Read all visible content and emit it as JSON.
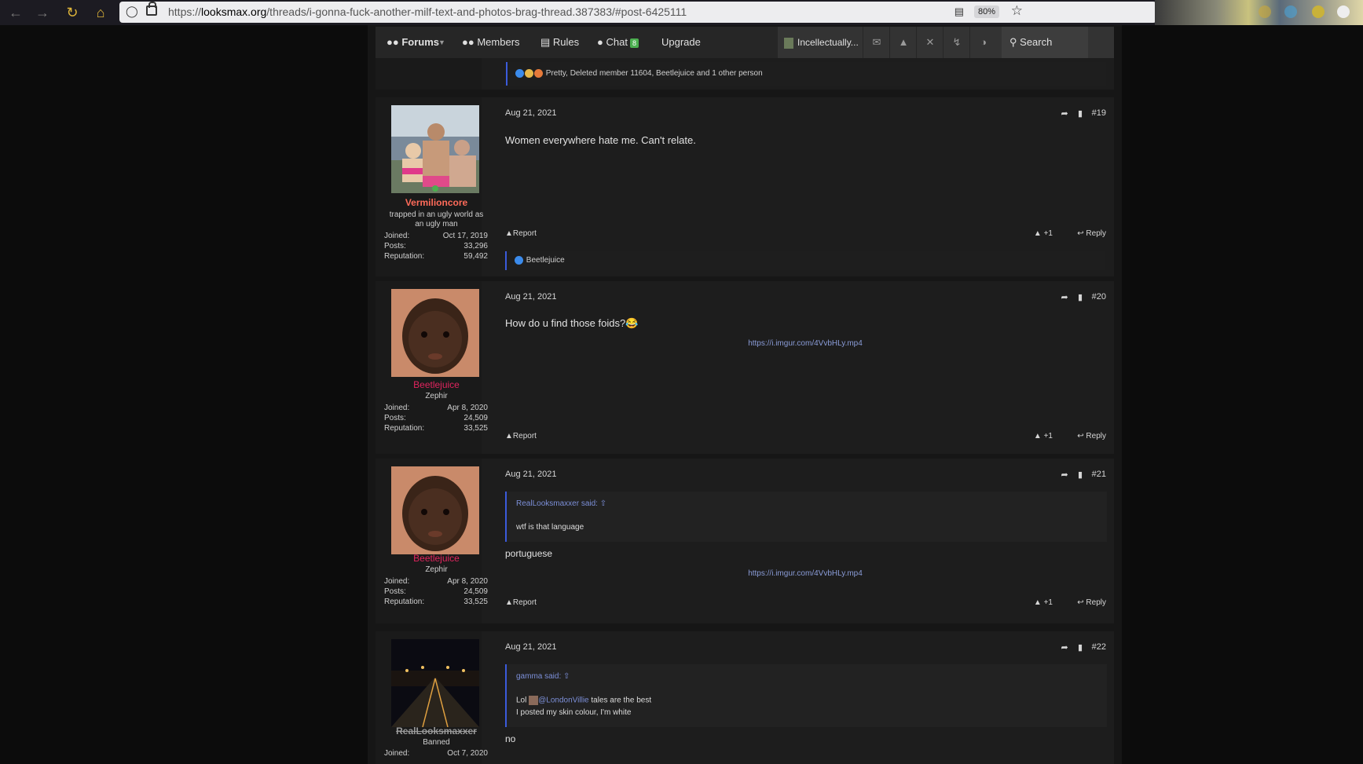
{
  "browser": {
    "url_prefix": "https://",
    "url_host": "looksmax.org",
    "url_path": "/threads/i-gonna-fuck-another-milf-text-and-photos-brag-thread.387383/#post-6425111",
    "zoom": "80%"
  },
  "nav": {
    "forums": "Forums",
    "members": "Members",
    "rules": "Rules",
    "chat": "Chat",
    "chat_badge": "8",
    "upgrade": "Upgrade",
    "account": "Incellectually...",
    "search": "Search"
  },
  "prev_post": {
    "reactions": "Pretty, Deleted member 11604, Beetlejuice and 1 other person"
  },
  "posts": [
    {
      "date": "Aug 21, 2021",
      "number": "#19",
      "username": "Vermilioncore",
      "user_title_1": "trapped in an ugly world as",
      "user_title_2": "an ugly man",
      "joined_label": "Joined:",
      "joined": "Oct 17, 2019",
      "posts_label": "Posts:",
      "posts": "33,296",
      "rep_label": "Reputation:",
      "reputation": "59,492",
      "body": "Women everywhere hate me. Can't relate.",
      "report": "Report",
      "plus": "+1",
      "reply": "Reply",
      "reactions": "Beetlejuice"
    },
    {
      "date": "Aug 21, 2021",
      "number": "#20",
      "username": "Beetlejuice",
      "user_title_1": "Zephir",
      "joined_label": "Joined:",
      "joined": "Apr 8, 2020",
      "posts_label": "Posts:",
      "posts": "24,509",
      "rep_label": "Reputation:",
      "reputation": "33,525",
      "body": "How do u find those foids?😂",
      "link": "https://i.imgur.com/4VvbHLy.mp4",
      "report": "Report",
      "plus": "+1",
      "reply": "Reply"
    },
    {
      "date": "Aug 21, 2021",
      "number": "#21",
      "username": "Beetlejuice",
      "user_title_1": "Zephir",
      "joined_label": "Joined:",
      "joined": "Apr 8, 2020",
      "posts_label": "Posts:",
      "posts": "24,509",
      "rep_label": "Reputation:",
      "reputation": "33,525",
      "quote_author": "RealLooksmaxxer said:",
      "quote_text": "wtf is that language",
      "body": "portuguese",
      "link": "https://i.imgur.com/4VvbHLy.mp4",
      "report": "Report",
      "plus": "+1",
      "reply": "Reply"
    },
    {
      "date": "Aug 21, 2021",
      "number": "#22",
      "username": "RealLooksmaxxer",
      "user_title_1": "Banned",
      "joined_label": "Joined:",
      "joined": "Oct 7, 2020",
      "quote_author": "gamma said:",
      "quote_line1_pre": "Lol",
      "quote_mention": "@LondonVillie",
      "quote_line1_post": "tales are the best",
      "quote_line2": "I posted my skin colour, I'm white",
      "body": "no"
    }
  ],
  "colors": {
    "accent": "#3b5bdb",
    "vermilion": "#ff6b5a",
    "beetlejuice": "#e0245e",
    "banned": "#9a9a9a"
  }
}
